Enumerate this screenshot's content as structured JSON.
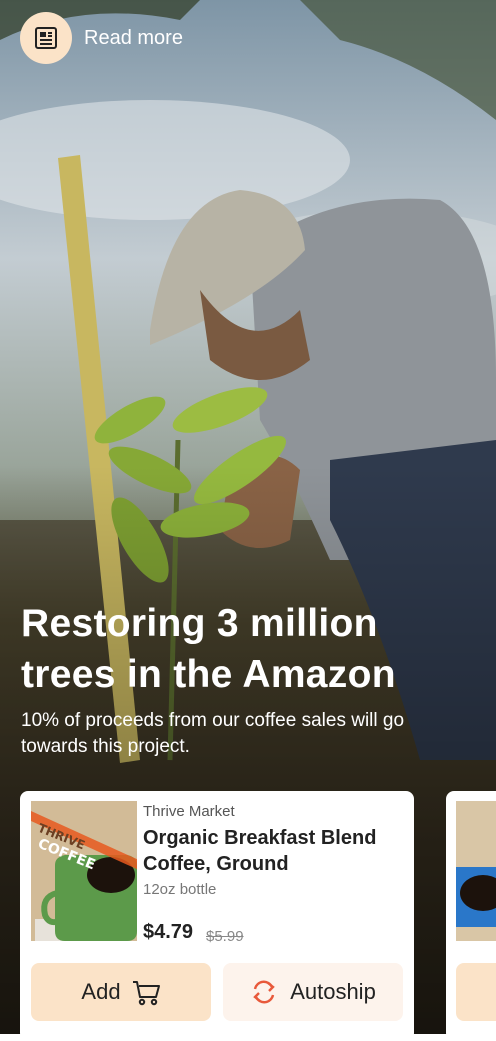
{
  "read_more": {
    "label": "Read more",
    "icon": "article-icon"
  },
  "hero": {
    "headline_line1": "Restoring 3 million",
    "headline_line2": "trees in the Amazon",
    "subtitle": "10% of proceeds from our coffee sales will go towards this project."
  },
  "product": {
    "brand": "Thrive Market",
    "name": "Organic Breakfast Blend Coffee, Ground",
    "size": "12oz bottle",
    "price": "$4.79",
    "original_price": "$5.99",
    "add_label": "Add",
    "autoship_label": "Autoship",
    "package_brand_text": "THRIVE",
    "package_product_text": "COFFEE"
  },
  "colors": {
    "accent": "#fbe3c8",
    "autoship_bg": "#fdf3ec",
    "autoship_icon": "#e8593b"
  }
}
